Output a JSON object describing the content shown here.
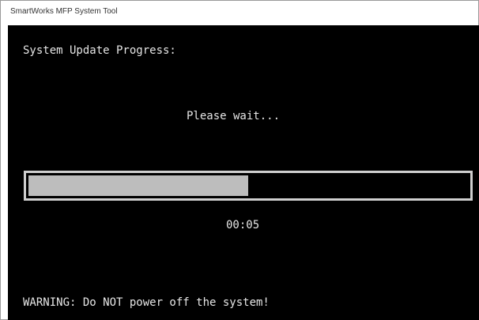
{
  "window": {
    "title": "SmartWorks MFP System Tool"
  },
  "console": {
    "heading": "System Update Progress:",
    "status": "Please wait...",
    "progress": {
      "fraction": 0.5
    },
    "elapsed": "00:05",
    "warning": "WARNING: Do NOT power off the system!"
  },
  "colors": {
    "console_background": "#000000",
    "console_text": "#e6e6e6",
    "progress_fill": "#bdbdbd",
    "progress_border": "#cfcfcf"
  }
}
